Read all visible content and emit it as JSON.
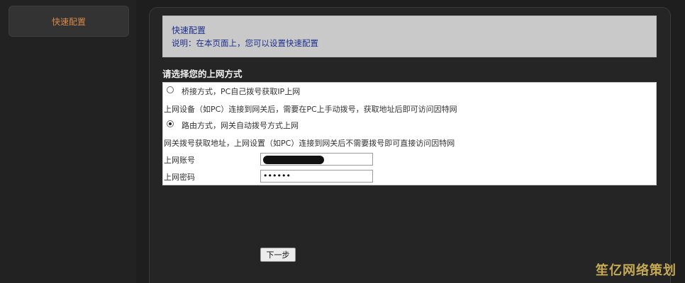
{
  "sidebar": {
    "items": [
      {
        "label": "快速配置"
      }
    ]
  },
  "header": {
    "title": "快速配置",
    "description": "说明：在本页面上，您可以设置快速配置"
  },
  "section": {
    "title": "请选择您的上网方式"
  },
  "options": [
    {
      "label": "桥接方式，PC自己拨号获取IP上网",
      "selected": false,
      "description": "上网设备（如PC）连接到网关后，需要在PC上手动拨号，获取地址后即可访问因特网"
    },
    {
      "label": "路由方式，网关自动拨号方式上网",
      "selected": true,
      "description": "网关拨号获取地址，上网设置（如PC）连接到网关后不需要拨号即可直接访问因特网"
    }
  ],
  "form": {
    "account_label": "上网账号",
    "account_value": "",
    "password_label": "上网密码",
    "password_value": "••••••"
  },
  "actions": {
    "next_label": "下一步"
  },
  "watermark": {
    "text": "笙亿网络策划"
  },
  "colors": {
    "accent_orange": "#d88a4a",
    "header_text_blue": "#1d2f8a",
    "background_dark": "#1f1e1e"
  }
}
